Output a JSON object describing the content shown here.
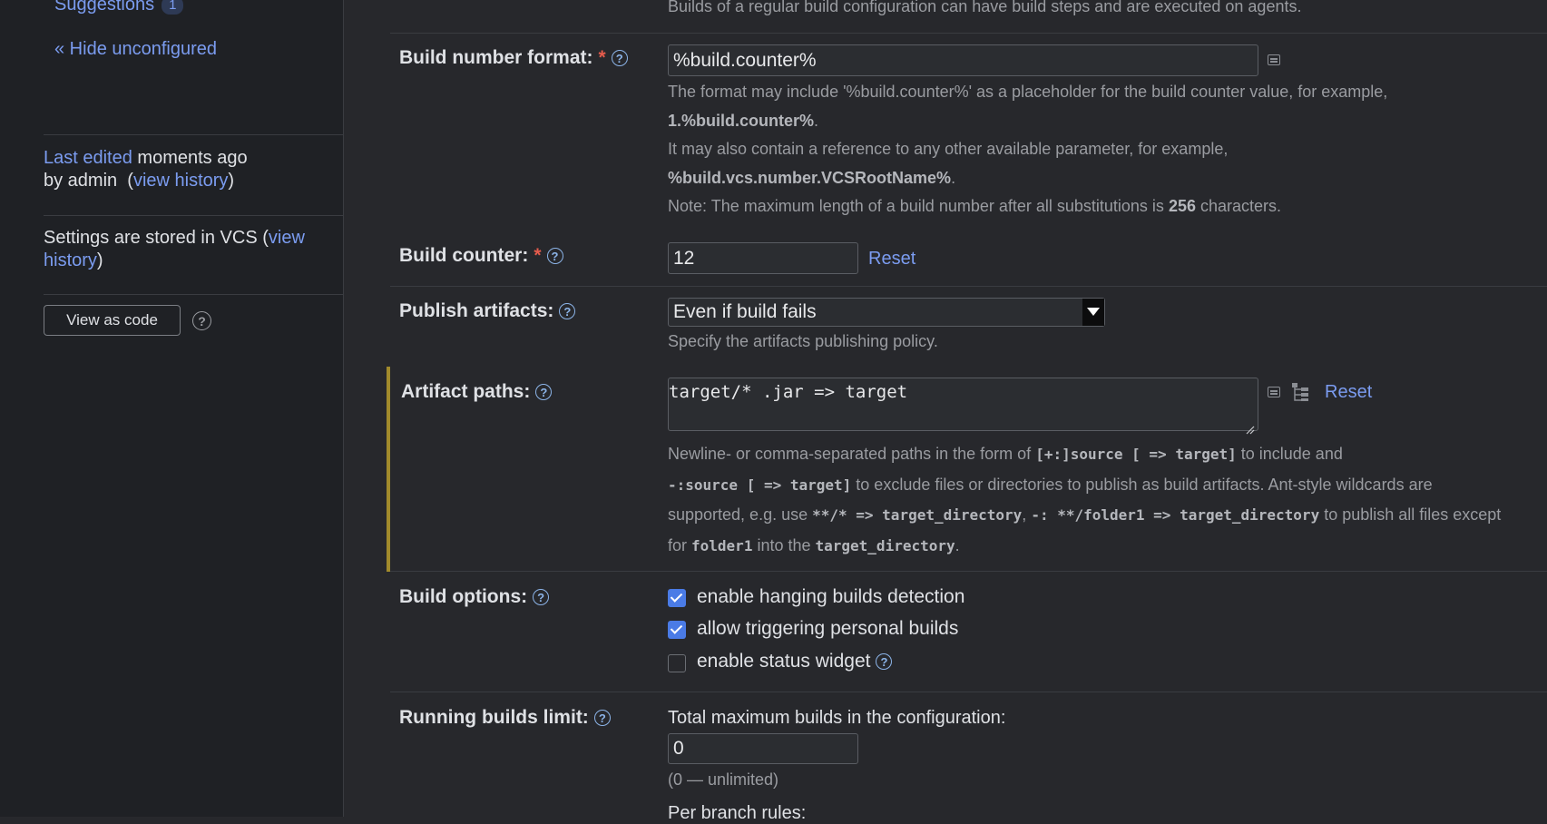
{
  "sidebar": {
    "suggestions_label": "Suggestions",
    "suggestions_count": "1",
    "hide_unconfigured": "« Hide unconfigured",
    "last_edited_link": "Last edited",
    "last_edited_rest": " moments ago",
    "by_admin": "by admin  (",
    "view_history": "view history",
    "close_paren": ")",
    "vcs_text": "Settings are stored in VCS (",
    "vcs_link1": "view",
    "vcs_link2": "history",
    "view_as_code": "View as code",
    "help_glyph": "?"
  },
  "main": {
    "top_hint": "Builds of a regular build configuration can have build steps and are executed on agents.",
    "build_number_format": {
      "label": "Build number format:",
      "required": "*",
      "value": "%build.counter%",
      "hint1": "The format may include '%build.counter%' as a placeholder for the build counter value, for example,",
      "hint2_bold": "1.%build.counter%",
      "hint3": "It may also contain a reference to any other available parameter, for example,",
      "hint4_bold": "%build.vcs.number.VCSRootName%",
      "hint5_pre": "Note: The maximum length of a build number after all substitutions is ",
      "hint5_bold": "256",
      "hint5_post": " characters.",
      "dot": "."
    },
    "build_counter": {
      "label": "Build counter:",
      "required": "*",
      "value": "12",
      "reset": "Reset"
    },
    "publish_artifacts": {
      "label": "Publish artifacts:",
      "selected": "Even if build fails",
      "hint": "Specify the artifacts publishing policy."
    },
    "artifact_paths": {
      "label": "Artifact paths:",
      "value": "target/* .jar => target",
      "reset": "Reset",
      "h1_pre": "Newline- or comma-separated paths in the form of ",
      "h1_code": "[+:]source [ => target]",
      "h1_post": " to include and",
      "h2_code": "-:source [ => target]",
      "h2_post": " to exclude files or directories to publish as build artifacts. Ant-style wildcards are",
      "h3_pre": "supported, e.g. use ",
      "h3_code1": "**/* => target_directory",
      "h3_mid": ", ",
      "h3_code2": "-: **/folder1 => target_directory",
      "h3_post": " to publish all files except",
      "h4_pre": "for ",
      "h4_code1": "folder1",
      "h4_mid": " into the ",
      "h4_code2": "target_directory",
      "h4_post": "."
    },
    "build_options": {
      "label": "Build options:",
      "opt1": "enable hanging builds detection",
      "opt2": "allow triggering personal builds",
      "opt3": "enable status widget"
    },
    "running_builds_limit": {
      "label": "Running builds limit:",
      "total_label": "Total maximum builds in the configuration:",
      "value": "0",
      "hint": "(0 — unlimited)",
      "per_branch": "Per branch rules:"
    }
  },
  "colors": {
    "background": "#27282c",
    "sidebar": "#1f2125",
    "link": "#7b9cf0",
    "required": "#e55b4c",
    "checkbox": "#4a7be6",
    "changed_marker": "#a18a2c"
  }
}
